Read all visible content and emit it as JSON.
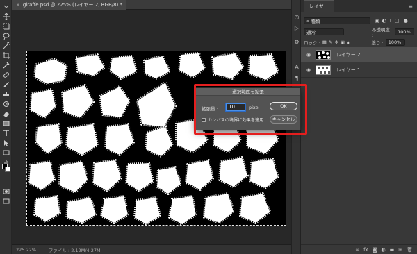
{
  "document": {
    "tab_title": "giraffe.psd @ 225% (レイヤー 2, RGB/8) *",
    "close_glyph": "×"
  },
  "status": {
    "zoom": "225.22%",
    "doc_info": "ファイル : 2.12M/4.27M"
  },
  "layers_panel": {
    "tab_label": "レイヤー",
    "menu_glyph": "≡",
    "filter_label": "種類",
    "blend_mode": "通常",
    "opacity_label": "不透明度 :",
    "opacity_value": "100%",
    "lock_label": "ロック :",
    "fill_label": "塗り :",
    "fill_value": "100%",
    "layers": [
      {
        "name": "レイヤー 2",
        "selected": true
      },
      {
        "name": "レイヤー 1",
        "selected": false
      }
    ],
    "bottom_icons": [
      "link-icon",
      "fx-icon",
      "mask-icon",
      "adjustment-icon",
      "folder-icon",
      "new-layer-icon",
      "trash-icon"
    ]
  },
  "dialog": {
    "title": "選択範囲を拡張",
    "expand_label": "拡張量 :",
    "expand_value": "10",
    "unit": "pixel",
    "checkbox_label": "カンバスの境界に効果を適用",
    "checkbox_checked": false,
    "ok_label": "OK",
    "cancel_label": "キャンセル"
  },
  "colors": {
    "highlight": "#e41e1e",
    "input_focus": "#4a8fe7",
    "foreground": "#000000",
    "background": "#ffffff"
  }
}
